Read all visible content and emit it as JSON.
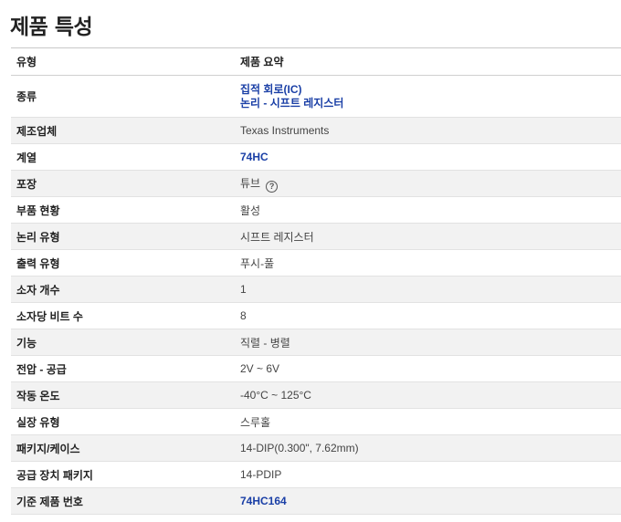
{
  "page": {
    "title": "제품 특성"
  },
  "table": {
    "header": {
      "col1": "유형",
      "col2": "제품 요약"
    },
    "rows": [
      {
        "label": "종류",
        "values": [
          "집적 회로(IC)",
          "논리 - 시프트 레지스터"
        ],
        "style": "link"
      },
      {
        "label": "제조업체",
        "value": "Texas Instruments",
        "style": "plain"
      },
      {
        "label": "계열",
        "value": "74HC",
        "style": "link"
      },
      {
        "label": "포장",
        "value": "튜브",
        "style": "plain",
        "icon": "help-circle-icon"
      },
      {
        "label": "부품 현황",
        "value": "활성",
        "style": "plain"
      },
      {
        "label": "논리 유형",
        "value": "시프트 레지스터",
        "style": "plain"
      },
      {
        "label": "출력 유형",
        "value": "푸시-풀",
        "style": "plain"
      },
      {
        "label": "소자 개수",
        "value": "1",
        "style": "plain"
      },
      {
        "label": "소자당 비트 수",
        "value": "8",
        "style": "plain"
      },
      {
        "label": "기능",
        "value": "직렬 - 병렬",
        "style": "plain"
      },
      {
        "label": "전압 - 공급",
        "value": "2V ~ 6V",
        "style": "plain"
      },
      {
        "label": "작동 온도",
        "value": "-40°C ~ 125°C",
        "style": "plain"
      },
      {
        "label": "실장 유형",
        "value": "스루홀",
        "style": "plain"
      },
      {
        "label": "패키지/케이스",
        "value": "14-DIP(0.300\", 7.62mm)",
        "style": "plain"
      },
      {
        "label": "공급 장치 패키지",
        "value": "14-PDIP",
        "style": "plain"
      },
      {
        "label": "기준 제품 번호",
        "value": "74HC164",
        "style": "link"
      }
    ]
  },
  "colors": {
    "link": "#1a3fa6",
    "zebra": "#f2f2f2"
  }
}
